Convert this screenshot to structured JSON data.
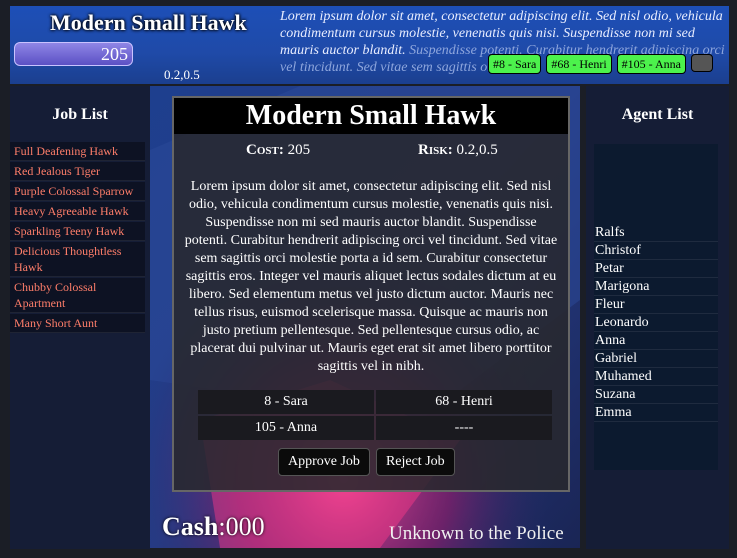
{
  "header": {
    "title": "Modern Small Hawk",
    "cost": "205",
    "risk": "0.2,0.5",
    "lorem_bright": "Lorem ipsum dolor sit amet, consectetur adipiscing elit. Sed nisl odio, vehicula condimentum cursus molestie, venenatis quis nisi. Suspendisse non mi sed mauris auctor blandit.",
    "lorem_faded": "Suspendisse potenti. Curabitur hendrerit adipiscing orci vel tincidunt. Sed vitae sem sagittis orci",
    "chips": [
      "#8 - Sara",
      "#68 - Henri",
      "#105 - Anna"
    ]
  },
  "job_list": {
    "title": "Job List",
    "items": [
      "Full Deafening Hawk",
      "Red Jealous Tiger",
      "Purple Colossal Sparrow",
      "Heavy Agreeable Hawk",
      "Sparkling Teeny Hawk",
      "Delicious Thoughtless Hawk",
      "Chubby Colossal Apartment",
      "Many Short Aunt"
    ]
  },
  "agent_list": {
    "title": "Agent List",
    "items": [
      "Ralfs",
      "Christof",
      "Petar",
      "Marigona",
      "Fleur",
      "Leonardo",
      "Anna",
      "Gabriel",
      "Muhamed",
      "Suzana",
      "Emma"
    ]
  },
  "card": {
    "title": "Modern Small Hawk",
    "cost_label": "Cost:",
    "cost_value": "205",
    "risk_label": "Risk:",
    "risk_value": "0.2,0.5",
    "description": "Lorem ipsum dolor sit amet, consectetur adipiscing elit. Sed nisl odio, vehicula condimentum cursus molestie, venenatis quis nisi. Suspendisse non mi sed mauris auctor blandit. Suspendisse potenti. Curabitur hendrerit adipiscing orci vel tincidunt. Sed vitae sem sagittis orci molestie porta a id sem. Curabitur consectetur sagittis eros. Integer vel mauris aliquet lectus sodales dictum at eu libero. Sed elementum metus vel justo dictum auctor. Mauris nec tellus risus, euismod scelerisque massa. Quisque ac mauris non justo pretium pellentesque. Sed pellentesque cursus odio, ac placerat dui pulvinar ut. Mauris eget erat sit amet libero porttitor sagittis vel in nibh.",
    "assignments": [
      "8 - Sara",
      "68 - Henri",
      "105 - Anna",
      "----"
    ],
    "approve_label": "Approve Job",
    "reject_label": "Reject Job"
  },
  "footer": {
    "cash_label": "Cash",
    "cash_value": "000",
    "status": "Unknown to the Police"
  },
  "colors": {
    "header_blue": "#1d4fb7",
    "chip_green": "#4cf24c",
    "job_text": "#ff7e6a",
    "accent_pink": "#e0307a"
  }
}
